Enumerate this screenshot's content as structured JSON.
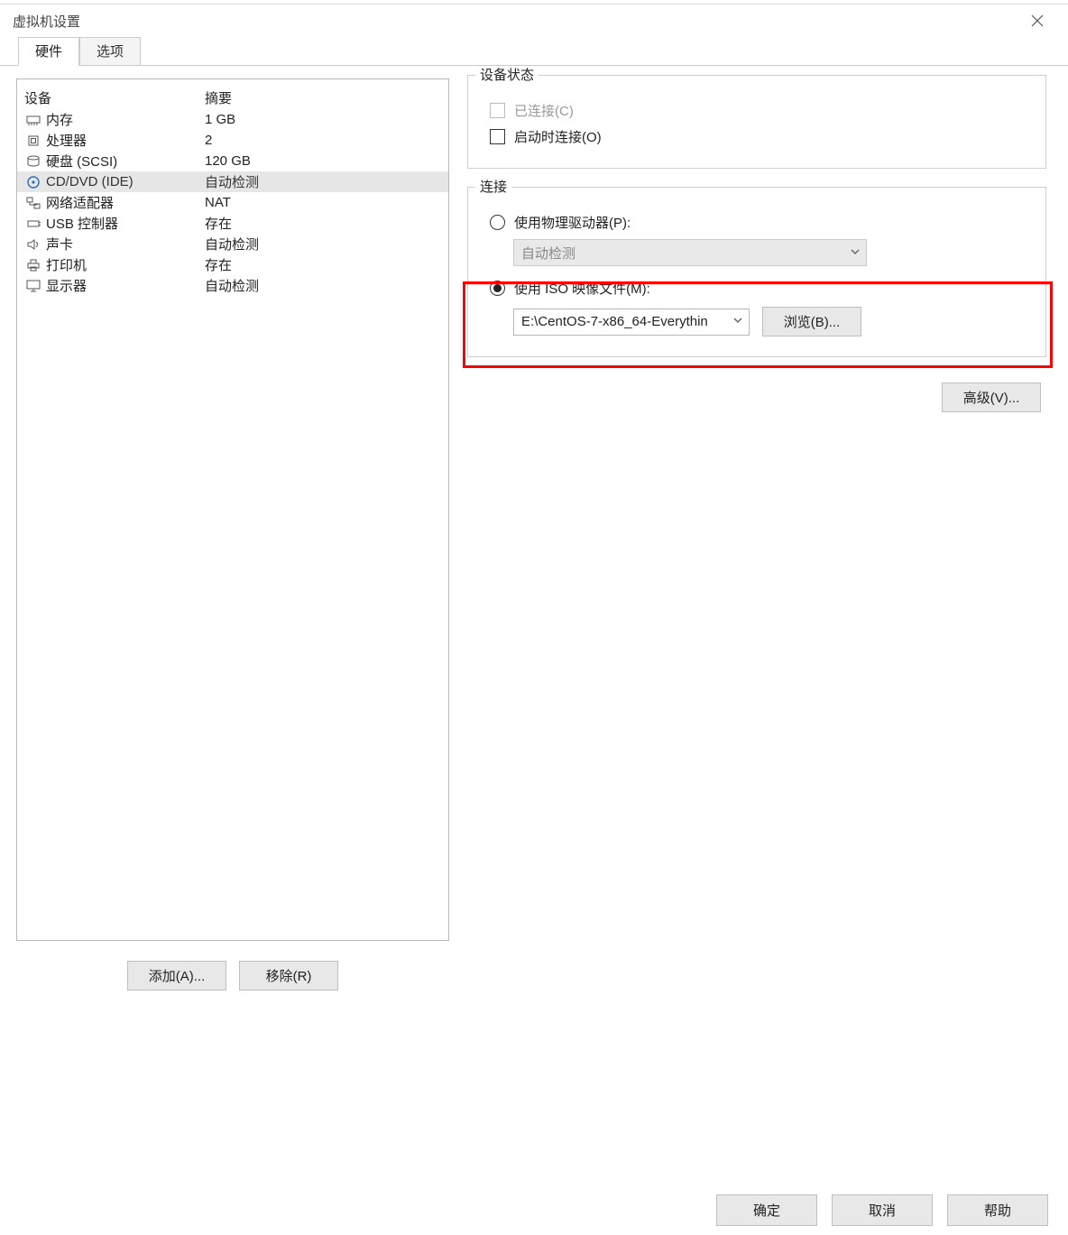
{
  "title": "虚拟机设置",
  "tabs": {
    "hardware": "硬件",
    "options": "选项"
  },
  "device_header": {
    "device": "设备",
    "summary": "摘要"
  },
  "devices": [
    {
      "icon": "memory-icon",
      "name": "内存",
      "summary": "1 GB"
    },
    {
      "icon": "cpu-icon",
      "name": "处理器",
      "summary": "2"
    },
    {
      "icon": "disk-icon",
      "name": "硬盘 (SCSI)",
      "summary": "120 GB"
    },
    {
      "icon": "cd-icon",
      "name": "CD/DVD (IDE)",
      "summary": "自动检测"
    },
    {
      "icon": "network-icon",
      "name": "网络适配器",
      "summary": "NAT"
    },
    {
      "icon": "usb-icon",
      "name": "USB 控制器",
      "summary": "存在"
    },
    {
      "icon": "sound-icon",
      "name": "声卡",
      "summary": "自动检测"
    },
    {
      "icon": "printer-icon",
      "name": "打印机",
      "summary": "存在"
    },
    {
      "icon": "display-icon",
      "name": "显示器",
      "summary": "自动检测"
    }
  ],
  "selected_device_index": 3,
  "device_status": {
    "legend": "设备状态",
    "connected": "已连接(C)",
    "connect_on_start": "启动时连接(O)"
  },
  "connection": {
    "legend": "连接",
    "use_physical": "使用物理驱动器(P):",
    "physical_auto": "自动检测",
    "use_iso": "使用 ISO 映像文件(M):",
    "iso_path": "E:\\CentOS-7-x86_64-Everythin",
    "browse": "浏览(B)..."
  },
  "advanced": "高级(V)...",
  "left_buttons": {
    "add": "添加(A)...",
    "remove": "移除(R)"
  },
  "footer": {
    "ok": "确定",
    "cancel": "取消",
    "help": "帮助"
  }
}
